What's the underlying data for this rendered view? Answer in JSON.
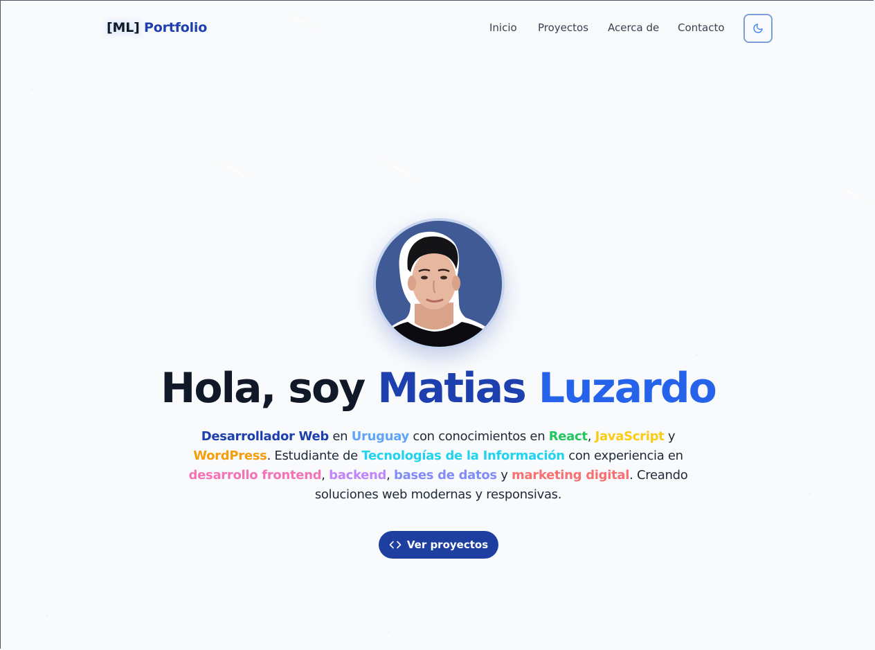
{
  "brand": {
    "bracket": "[ML]",
    "name": "Portfolio"
  },
  "nav": {
    "items": [
      {
        "label": "Inicio"
      },
      {
        "label": "Proyectos"
      },
      {
        "label": "Acerca de"
      },
      {
        "label": "Contacto"
      }
    ],
    "theme_toggle_icon": "moon-icon"
  },
  "hero": {
    "title_prefix": "Hola, soy",
    "first_name": "Matias",
    "last_name": "Luzardo",
    "avatar_icon": "profile-photo",
    "description": {
      "role": "Desarrollador Web",
      "t_en": "en",
      "country": "Uruguay",
      "t_conocimientos": "con conocimientos en",
      "tech1": "React",
      "comma1": ",",
      "tech2": "JavaScript",
      "t_y1": "y",
      "tech3": "WordPress",
      "period1": ".",
      "t_estudiante": "Estudiante de",
      "field": "Tecnologías de la Información",
      "t_experiencia": "con experiencia en",
      "skill1": "desarrollo frontend",
      "comma2": ",",
      "skill2": "backend",
      "comma3": ",",
      "skill3": "bases de datos",
      "t_y2": "y",
      "skill4": "marketing digital",
      "t_ending": ". Creando soluciones web modernas y responsivas."
    },
    "cta_label": "Ver proyectos",
    "cta_icon": "code-icon"
  },
  "colors": {
    "role": "#1e40af",
    "country": "#60a5fa",
    "react": "#22c55e",
    "javascript": "#facc15",
    "wordpress": "#f59e0b",
    "field": "#22d3ee",
    "frontend": "#f472b6",
    "backend": "#c084fc",
    "databases": "#818cf8",
    "marketing": "#f87171",
    "cta_bg": "#1e3fa0"
  }
}
